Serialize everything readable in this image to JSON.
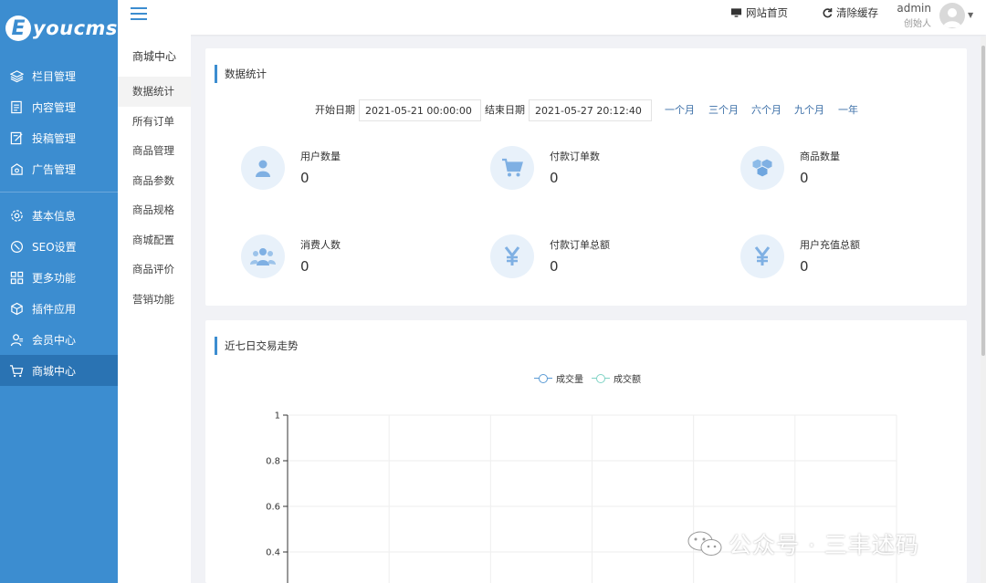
{
  "brand": {
    "logo_letter": "E",
    "logo_text": "youcms"
  },
  "sidebar": {
    "items": [
      {
        "label": "栏目管理",
        "icon": "layers-icon"
      },
      {
        "label": "内容管理",
        "icon": "document-icon"
      },
      {
        "label": "投稿管理",
        "icon": "edit-icon"
      },
      {
        "label": "广告管理",
        "icon": "ad-icon"
      },
      {
        "label": "基本信息",
        "icon": "gear-icon"
      },
      {
        "label": "SEO设置",
        "icon": "seo-icon"
      },
      {
        "label": "更多功能",
        "icon": "apps-icon"
      },
      {
        "label": "插件应用",
        "icon": "cube-icon"
      },
      {
        "label": "会员中心",
        "icon": "user-icon"
      },
      {
        "label": "商城中心",
        "icon": "cart-icon",
        "active": true
      }
    ]
  },
  "subnav": {
    "title": "商城中心",
    "items": [
      "数据统计",
      "所有订单",
      "商品管理",
      "商品参数",
      "商品规格",
      "商城配置",
      "商品评价",
      "营销功能"
    ],
    "active_index": 0
  },
  "topbar": {
    "home_label": "网站首页",
    "clear_cache_label": "清除缓存",
    "user_name": "admin",
    "user_role": "创始人"
  },
  "stats_panel": {
    "title": "数据统计",
    "start_label": "开始日期",
    "start_value": "2021-05-21 00:00:00",
    "end_label": "结束日期",
    "end_value": "2021-05-27 20:12:40",
    "ranges": [
      "一个月",
      "三个月",
      "六个月",
      "九个月",
      "一年"
    ],
    "stats": [
      {
        "label": "用户数量",
        "value": "0",
        "icon": "user-icon"
      },
      {
        "label": "付款订单数",
        "value": "0",
        "icon": "cart-icon"
      },
      {
        "label": "商品数量",
        "value": "0",
        "icon": "boxes-icon"
      },
      {
        "label": "消费人数",
        "value": "0",
        "icon": "group-icon"
      },
      {
        "label": "付款订单总额",
        "value": "0",
        "icon": "yen-icon"
      },
      {
        "label": "用户充值总额",
        "value": "0",
        "icon": "yen-icon"
      }
    ]
  },
  "chart_panel": {
    "title": "近七日交易走势"
  },
  "chart_data": {
    "type": "line",
    "title": "近七日交易走势",
    "series": [
      {
        "name": "成交量",
        "color": "#5b9bd5",
        "values": []
      },
      {
        "name": "成交额",
        "color": "#7fd3c5",
        "values": []
      }
    ],
    "y_ticks": [
      "1",
      "0.8",
      "0.6",
      "0.4"
    ],
    "ylim": [
      0,
      1
    ],
    "grid": true,
    "legend": "top-center"
  },
  "watermark": "公众号 · 三丰述码"
}
